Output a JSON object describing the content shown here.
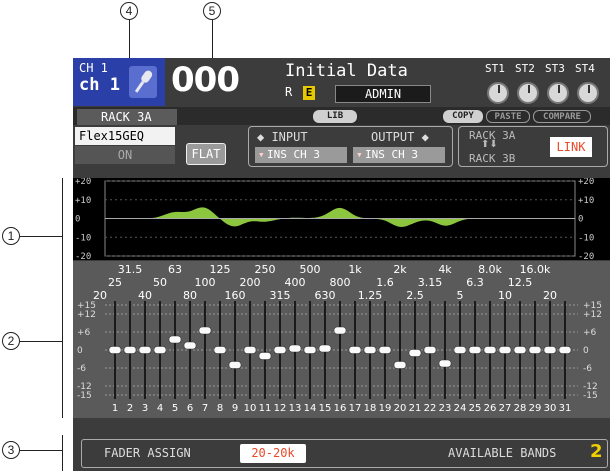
{
  "callouts": {
    "c1": "1",
    "c2": "2",
    "c3": "3",
    "c4": "4",
    "c5": "5"
  },
  "header": {
    "channel_line1": "CH 1",
    "channel_line2": "ch 1",
    "channel_icon": "microphone-icon",
    "scene_number": "000",
    "scene_title": "Initial Data",
    "scene_flag_r": "R",
    "scene_flag_e": "E",
    "user": "ADMIN",
    "st_labels": [
      "ST1",
      "ST2",
      "ST3",
      "ST4"
    ]
  },
  "tabs": {
    "rack": "RACK 3A",
    "lib": "LIB",
    "copy": "COPY",
    "paste": "PASTE",
    "compare": "COMPARE"
  },
  "eq": {
    "type": "Flex15GEQ",
    "on_label": "ON",
    "flat_label": "FLAT"
  },
  "io": {
    "input_label": "INPUT",
    "output_label": "OUTPUT",
    "input_value": "INS CH 3",
    "output_value": "INS CH 3"
  },
  "link": {
    "rack_a": "RACK 3A",
    "rack_b": "RACK 3B",
    "link_label": "LINK"
  },
  "graph": {
    "y_labels": [
      "+20",
      "+10",
      "0",
      "-10",
      "-20"
    ]
  },
  "faders": {
    "freq_row1": [
      "31.5",
      "63",
      "125",
      "250",
      "500",
      "1k",
      "2k",
      "4k",
      "8.0k",
      "16.0k"
    ],
    "freq_row2": [
      "25",
      "50",
      "100",
      "200",
      "400",
      "800",
      "1.6",
      "3.15",
      "6.3",
      "12.5"
    ],
    "freq_row3": [
      "20",
      "40",
      "80",
      "160",
      "315",
      "630",
      "1.25",
      "2.5",
      "5",
      "10",
      "20"
    ],
    "y_labels": [
      "+15",
      "+12",
      "+6",
      "0",
      "-6",
      "-12",
      "-15"
    ],
    "band_numbers": [
      "1",
      "2",
      "3",
      "4",
      "5",
      "6",
      "7",
      "8",
      "9",
      "10",
      "11",
      "12",
      "13",
      "14",
      "15",
      "16",
      "17",
      "18",
      "19",
      "20",
      "21",
      "22",
      "23",
      "24",
      "25",
      "26",
      "27",
      "28",
      "29",
      "30",
      "31"
    ],
    "gains_db": [
      0,
      0,
      0,
      0,
      3.5,
      1.5,
      6.5,
      0,
      -5,
      0,
      -2,
      0,
      0.5,
      0,
      0.5,
      6.5,
      0,
      0,
      0,
      -5,
      -1,
      0,
      -4.5,
      0,
      0,
      0,
      0,
      0,
      0,
      0,
      0
    ]
  },
  "footer": {
    "fader_assign_label": "FADER ASSIGN",
    "fader_assign_value": "20-20k",
    "available_bands_label": "AVAILABLE BANDS",
    "available_bands_value": "2"
  },
  "colors": {
    "eq_fill": "#8cc63f",
    "link_text": "#e84a2a",
    "accent_yellow": "#f0d000",
    "channel_blue": "#2a3fa8"
  }
}
